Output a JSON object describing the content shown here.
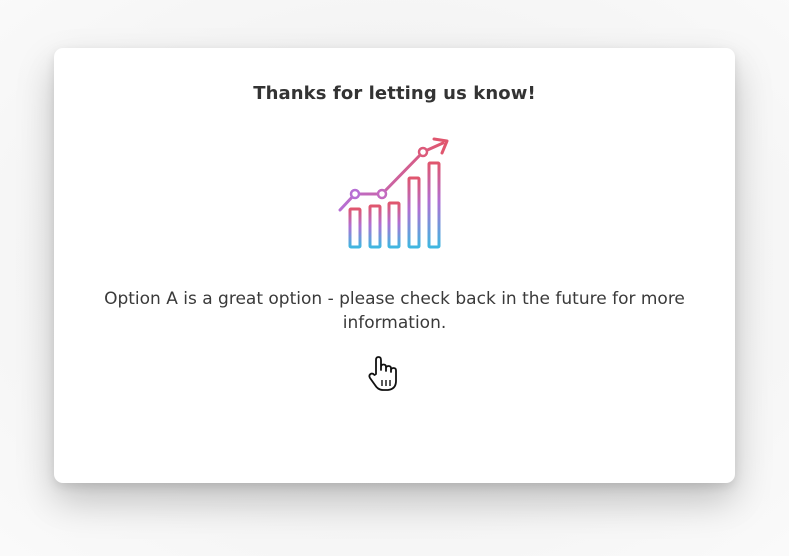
{
  "dialog": {
    "title": "Thanks for letting us know!",
    "message": "Option A is a great option - please check back in the future for more information.",
    "icon": "growth-chart-icon",
    "gradient_colors": {
      "top": "#e0566e",
      "mid": "#b06fd3",
      "bottom": "#3fb7e0"
    }
  },
  "cursor": {
    "icon": "hand-pointer-icon"
  }
}
